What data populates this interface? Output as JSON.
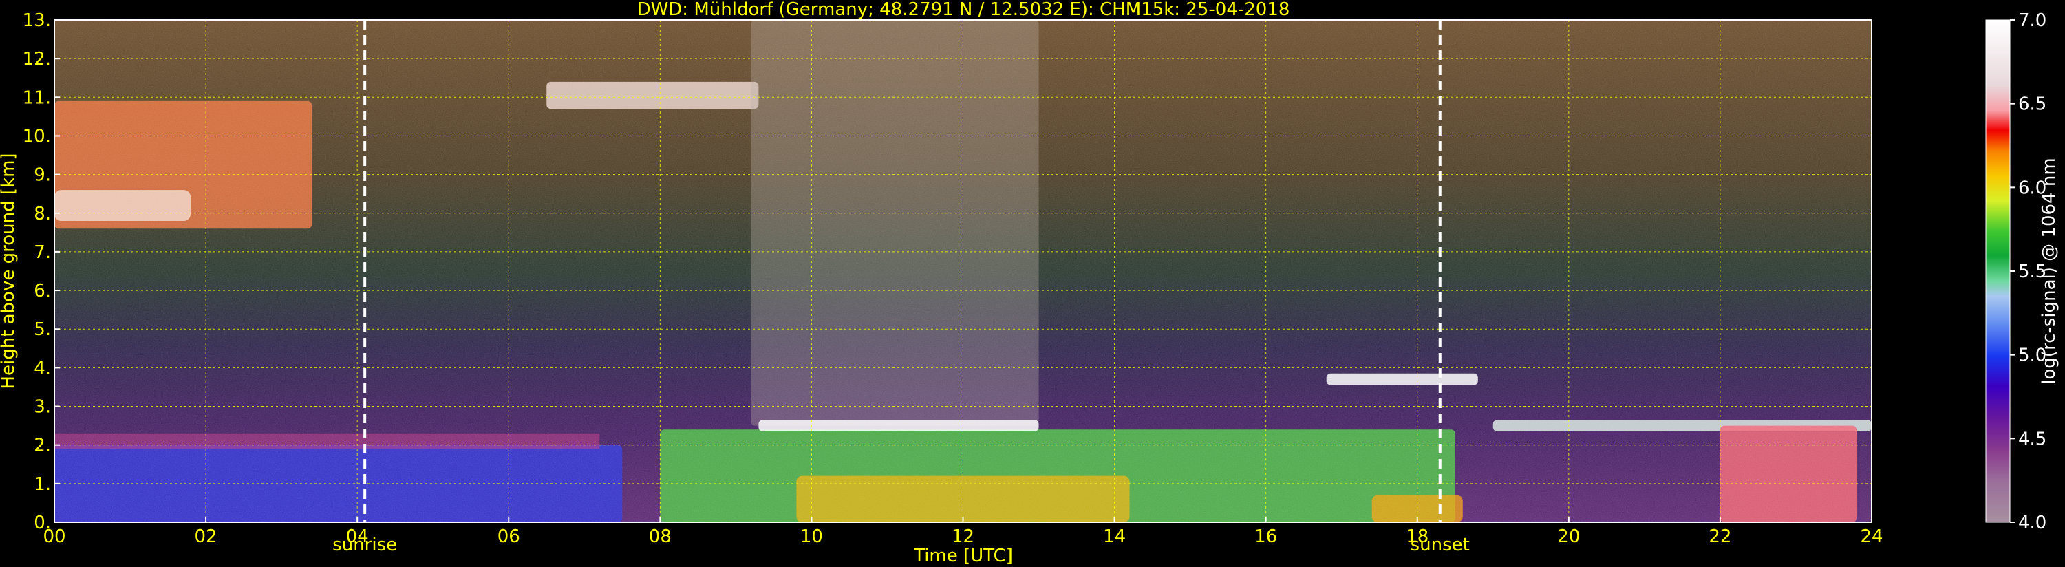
{
  "chart_data": {
    "type": "heatmap",
    "title": "DWD: Mühldorf (Germany; 48.2791 N / 12.5032 E):    CHM15k: 25-04-2018",
    "xlabel": "Time [UTC]",
    "ylabel": "Height above ground [km]",
    "xlim": [
      0,
      24
    ],
    "ylim": [
      0,
      13
    ],
    "x_ticks": [
      "00",
      "02",
      "04",
      "06",
      "08",
      "10",
      "12",
      "14",
      "16",
      "18",
      "20",
      "22",
      "24"
    ],
    "y_ticks": [
      "0.",
      "1.",
      "2.",
      "3.",
      "4.",
      "5.",
      "6.",
      "7.",
      "8.",
      "9.",
      "10.",
      "11.",
      "12.",
      "13."
    ],
    "grid": true,
    "events": [
      {
        "label": "sunrise",
        "time_h": 4.1
      },
      {
        "label": "sunset",
        "time_h": 18.3
      }
    ],
    "colorbar": {
      "label": "log(rc-signal) @ 1064 nm",
      "range": [
        4.0,
        7.0
      ],
      "ticks": [
        "4.0",
        "4.5",
        "5.0",
        "5.5",
        "6.0",
        "6.5",
        "7.0"
      ]
    },
    "features": [
      {
        "kind": "cirrus cloud",
        "t_start": 0.0,
        "t_end": 3.4,
        "h_bottom": 7.6,
        "h_top": 10.9
      },
      {
        "kind": "upper cloud fragments",
        "t_start": 6.5,
        "t_end": 9.3,
        "h_bottom": 10.7,
        "h_top": 11.4
      },
      {
        "kind": "high noise region",
        "t_start": 9.2,
        "t_end": 13.0,
        "h_bottom": 2.5,
        "h_top": 13.0
      },
      {
        "kind": "residual layer",
        "t_start": 0.0,
        "t_end": 7.5,
        "h_bottom": 0.0,
        "h_top": 2.0
      },
      {
        "kind": "convective boundary layer",
        "t_start": 8.0,
        "t_end": 18.5,
        "h_bottom": 0.0,
        "h_top": 2.4
      },
      {
        "kind": "cloud tops",
        "t_start": 9.3,
        "t_end": 13.0,
        "h": 2.5
      },
      {
        "kind": "evening cloud layer",
        "t_start": 16.8,
        "t_end": 18.8,
        "h": 3.7
      },
      {
        "kind": "cloud layer",
        "t_start": 19.0,
        "t_end": 24.0,
        "h": 2.5
      },
      {
        "kind": "precipitation streaks",
        "t_start": 22.0,
        "t_end": 23.8,
        "h_bottom": 0.0,
        "h_top": 2.5
      }
    ]
  },
  "colors": {
    "text": "#ffff00",
    "grid": "#ffff00",
    "axes": "#ffffff"
  }
}
